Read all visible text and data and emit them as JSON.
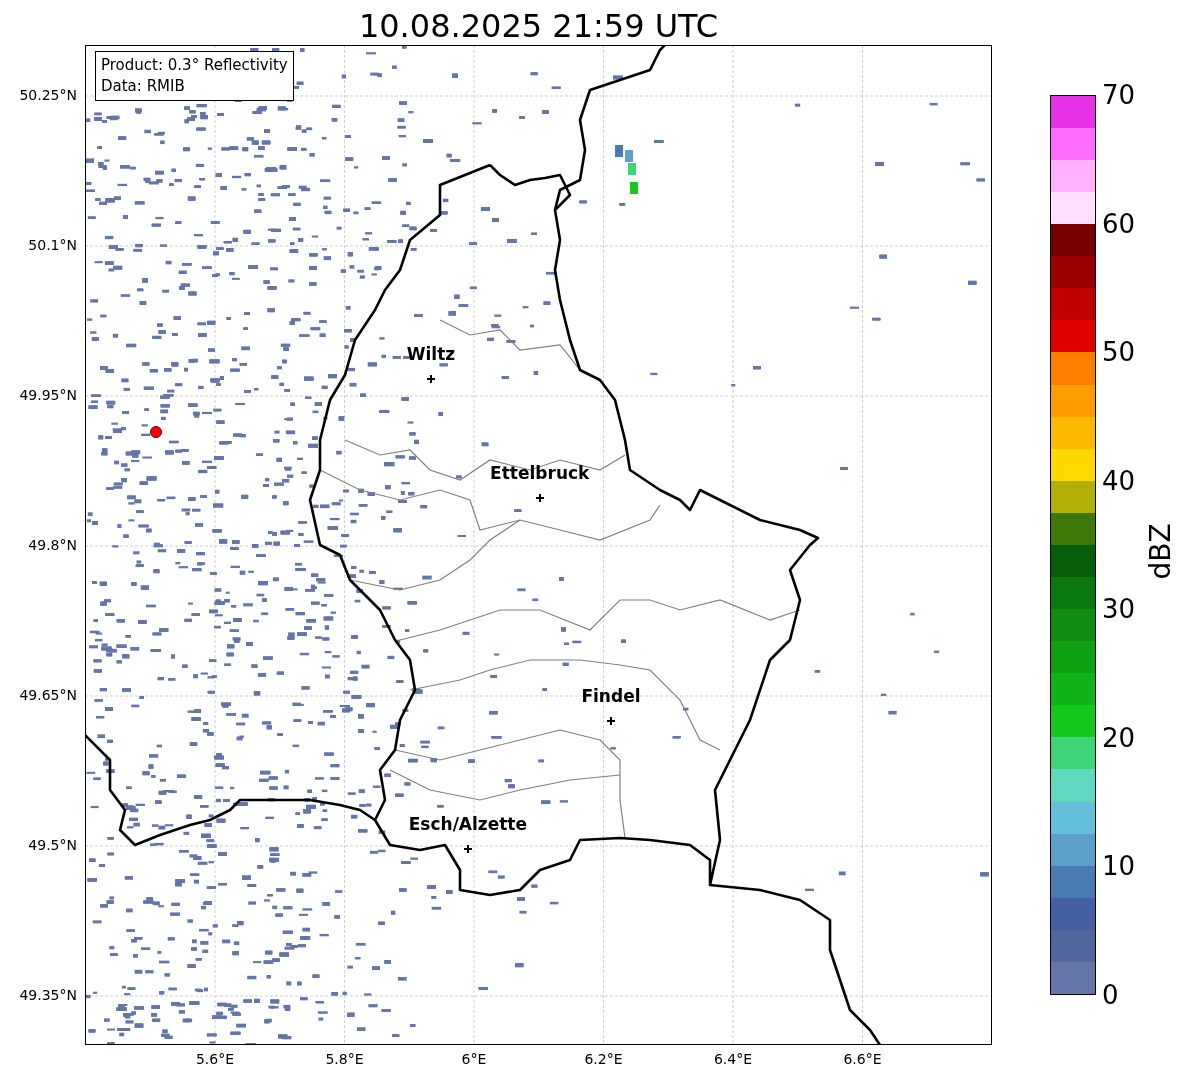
{
  "title": "10.08.2025 21:59 UTC",
  "info_box": [
    "Product: 0.3° Reflectivity",
    "Data: RMIB"
  ],
  "map": {
    "lat_ticks": [
      "50.25°N",
      "50.1°N",
      "49.95°N",
      "49.8°N",
      "49.65°N",
      "49.5°N",
      "49.35°N"
    ],
    "lon_ticks": [
      "5.6°E",
      "5.8°E",
      "6°E",
      "6.2°E",
      "6.4°E",
      "6.6°E"
    ],
    "places": [
      {
        "name": "Wiltz"
      },
      {
        "name": "Ettelbruck"
      },
      {
        "name": "Findel"
      },
      {
        "name": "Esch/Alzette"
      }
    ]
  },
  "colorbar": {
    "label": "dBZ",
    "ticks": [
      "70",
      "60",
      "50",
      "40",
      "30",
      "20",
      "10",
      "0"
    ]
  }
}
